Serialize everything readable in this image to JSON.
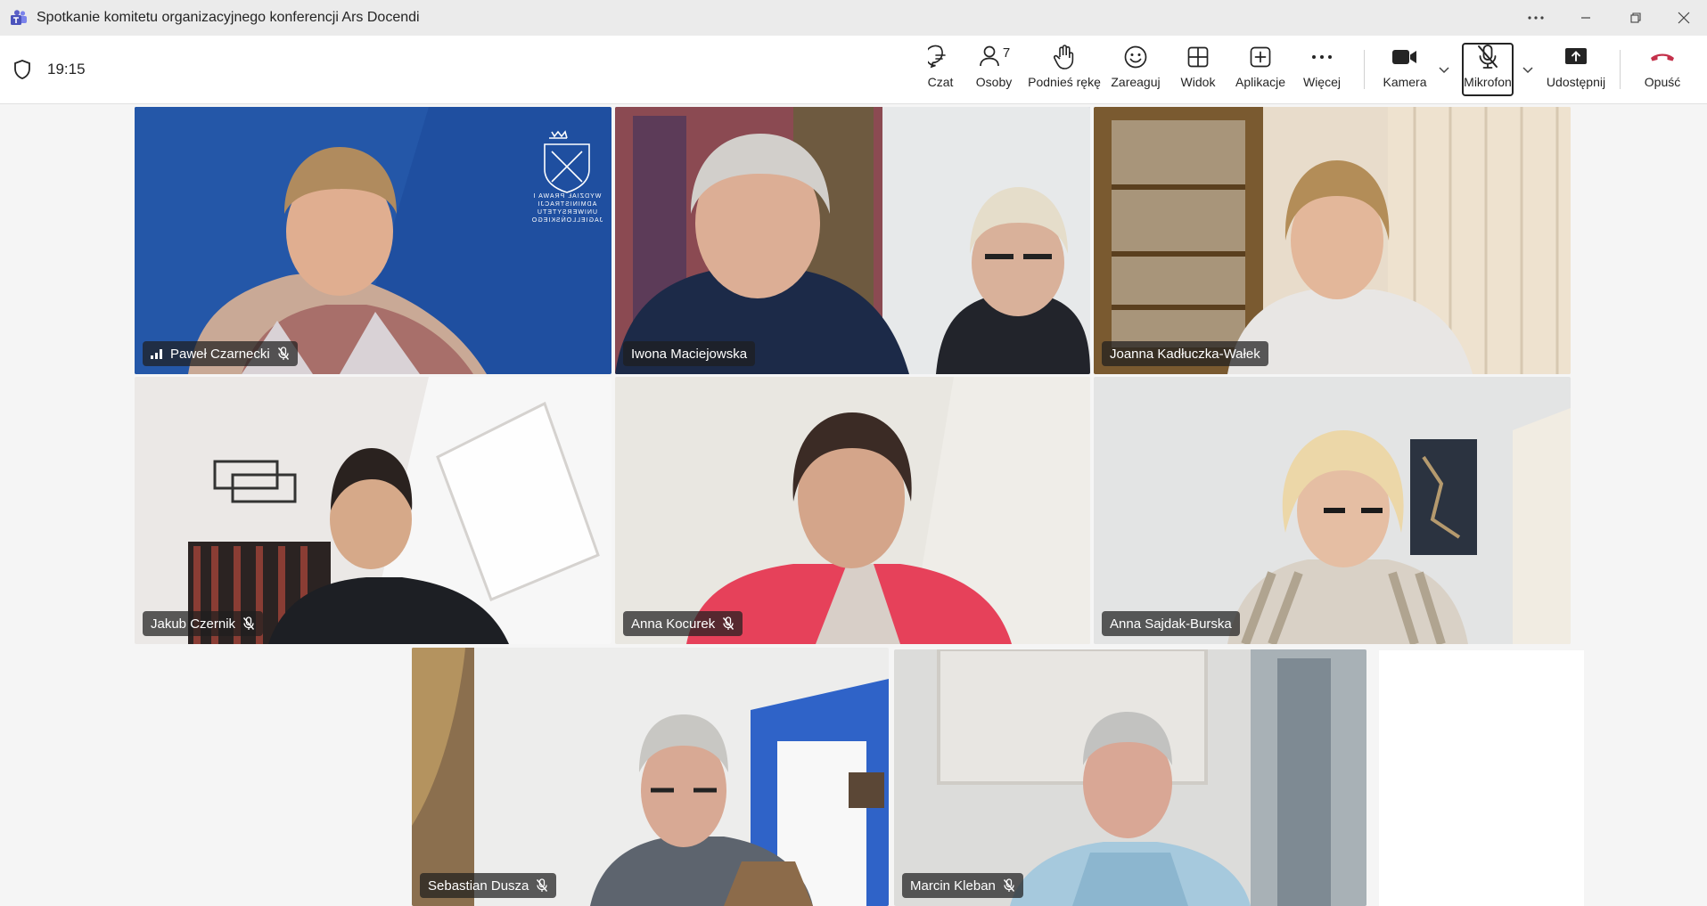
{
  "window": {
    "title": "Spotkanie komitetu organizacyjnego konferencji Ars Docendi",
    "app_icon": "teams-icon",
    "controls": [
      "more-icon",
      "minimize-icon",
      "restore-icon",
      "close-icon"
    ]
  },
  "toolbar": {
    "time": "19:15",
    "buttons": {
      "chat": {
        "label": "Czat",
        "icon": "chat-icon"
      },
      "people": {
        "label": "Osoby",
        "icon": "people-icon",
        "count": "7"
      },
      "raise": {
        "label": "Podnieś rękę",
        "icon": "raise-hand-icon"
      },
      "react": {
        "label": "Zareaguj",
        "icon": "smiley-icon"
      },
      "view": {
        "label": "Widok",
        "icon": "grid-icon"
      },
      "apps": {
        "label": "Aplikacje",
        "icon": "plus-box-icon"
      },
      "more": {
        "label": "Więcej",
        "icon": "ellipsis-icon"
      },
      "camera": {
        "label": "Kamera",
        "icon": "camera-icon"
      },
      "mic": {
        "label": "Mikrofon",
        "icon": "mic-off-icon"
      },
      "share": {
        "label": "Udostępnij",
        "icon": "share-icon"
      },
      "leave": {
        "label": "Opuść",
        "icon": "hang-up-icon"
      }
    },
    "colors": {
      "leave": "#c4314b",
      "accent": "#5b5fc7"
    }
  },
  "participants": [
    {
      "name": "Paweł Czarnecki",
      "muted": true,
      "signal": true,
      "active": false,
      "bg_text": "WYDZIAŁ PRAWA I ADMINISTRACJI UNIWERSYTETU JAGIELLOŃSKIEGO"
    },
    {
      "name": "Iwona Maciejowska",
      "muted": false,
      "active": true
    },
    {
      "name": "Joanna Kadłuczka-Wałek",
      "muted": false,
      "active": false
    },
    {
      "name": "Jakub Czernik",
      "muted": true,
      "active": false
    },
    {
      "name": "Anna Kocurek",
      "muted": true,
      "active": false
    },
    {
      "name": "Anna Sajdak-Burska",
      "muted": false,
      "active": false
    },
    {
      "name": "Sebastian Dusza",
      "muted": true,
      "active": false
    },
    {
      "name": "Marcin Kleban",
      "muted": true,
      "active": false
    }
  ]
}
